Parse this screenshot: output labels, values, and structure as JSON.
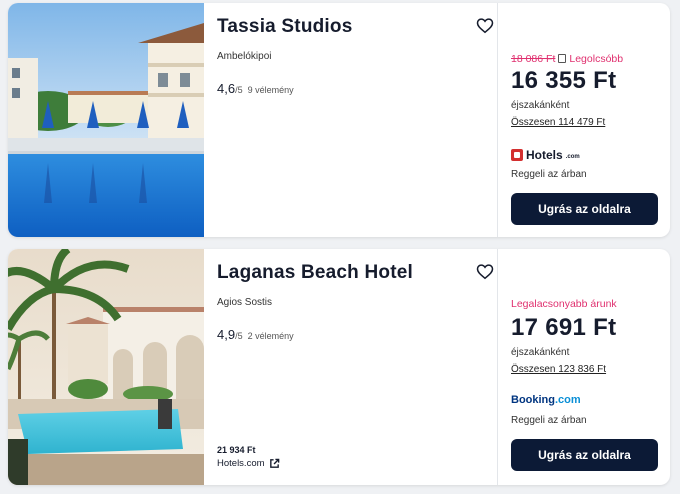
{
  "listings": [
    {
      "name": "Tassia Studios",
      "location": "Ambelókipoi",
      "rating": "4,6",
      "rating_scale": "/5",
      "reviews": "9 vélemény",
      "badge_old_price": "18 086 Ft",
      "badge_text": "Legolcsóbb",
      "price": "16 355 Ft",
      "per_night": "éjszakánként",
      "total": "Összesen 114 479 Ft",
      "provider": "Hotels",
      "provider_suffix": ".com",
      "breakfast": "Reggeli az árban",
      "cta": "Ugrás az oldalra"
    },
    {
      "name": "Laganas Beach Hotel",
      "location": "Agios Sostis",
      "rating": "4,9",
      "rating_scale": "/5",
      "reviews": "2 vélemény",
      "badge_text": "Legalacsonyabb árunk",
      "price": "17 691 Ft",
      "per_night": "éjszakánként",
      "total": "Összesen 123 836 Ft",
      "provider": "Booking",
      "provider_suffix": ".com",
      "breakfast": "Reggeli az árban",
      "cta": "Ugrás az oldalra",
      "alt_price": "21 934 Ft",
      "alt_provider": "Hotels.com"
    }
  ],
  "colors": {
    "accent_pink": "#e0306f",
    "button_dark": "#0c1a36",
    "hotels_red": "#d32f2f",
    "booking_navy": "#003580",
    "booking_blue": "#0a8fd6"
  },
  "icons": {
    "favorite": "heart-outline-icon",
    "external": "external-link-icon",
    "lock": "lock-icon"
  }
}
